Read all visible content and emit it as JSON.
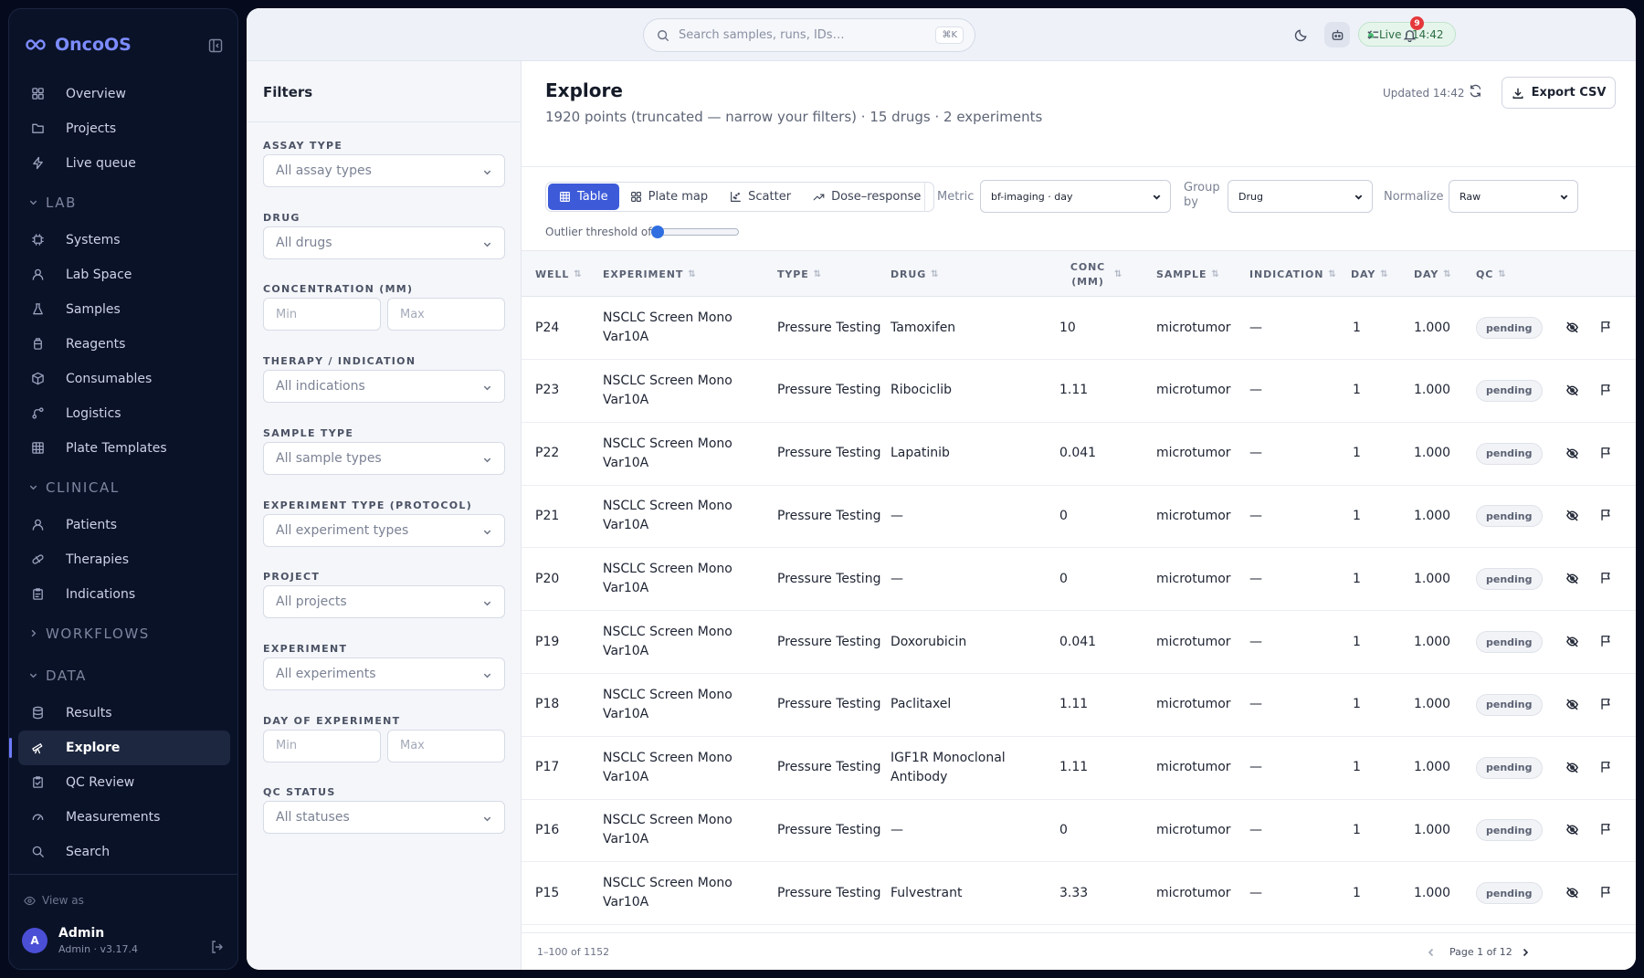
{
  "app": {
    "name": "OncoOS"
  },
  "sidebar": {
    "top_items": [
      {
        "label": "Overview",
        "icon": "grid-icon"
      },
      {
        "label": "Projects",
        "icon": "folder-icon"
      },
      {
        "label": "Live queue",
        "icon": "bolt-icon"
      }
    ],
    "sections": [
      {
        "label": "LAB",
        "expanded": true,
        "items": [
          {
            "label": "Systems",
            "icon": "chip-icon"
          },
          {
            "label": "Lab Space",
            "icon": "user-icon"
          },
          {
            "label": "Samples",
            "icon": "flask-icon"
          },
          {
            "label": "Reagents",
            "icon": "bottle-icon"
          },
          {
            "label": "Consumables",
            "icon": "box-icon"
          },
          {
            "label": "Logistics",
            "icon": "route-icon"
          },
          {
            "label": "Plate Templates",
            "icon": "table-icon"
          }
        ]
      },
      {
        "label": "CLINICAL",
        "expanded": true,
        "items": [
          {
            "label": "Patients",
            "icon": "user-icon"
          },
          {
            "label": "Therapies",
            "icon": "pill-icon"
          },
          {
            "label": "Indications",
            "icon": "clipboard-icon"
          }
        ]
      },
      {
        "label": "WORKFLOWS",
        "expanded": false,
        "items": []
      },
      {
        "label": "DATA",
        "expanded": true,
        "items": [
          {
            "label": "Results",
            "icon": "database-icon"
          },
          {
            "label": "Explore",
            "icon": "telescope-icon",
            "active": true
          },
          {
            "label": "QC Review",
            "icon": "clipboard-check-icon"
          },
          {
            "label": "Measurements",
            "icon": "gauge-icon"
          },
          {
            "label": "Search",
            "icon": "search-icon"
          }
        ]
      }
    ],
    "view_as": "View as",
    "user": {
      "initial": "A",
      "name": "Admin",
      "sub": "Admin · v3.17.4"
    }
  },
  "topbar": {
    "search_placeholder": "Search samples, runs, IDs…",
    "shortcut": "⌘K",
    "live_label": "Live · 14:42",
    "notifications": "9"
  },
  "filters": {
    "title": "Filters",
    "groups": [
      {
        "label": "ASSAY TYPE",
        "kind": "select",
        "value": "All assay types"
      },
      {
        "label": "DRUG",
        "kind": "select",
        "value": "All drugs"
      },
      {
        "label": "CONCENTRATION (MM)",
        "kind": "range",
        "min": "Min",
        "max": "Max"
      },
      {
        "label": "THERAPY / INDICATION",
        "kind": "select",
        "value": "All indications"
      },
      {
        "label": "SAMPLE TYPE",
        "kind": "select",
        "value": "All sample types"
      },
      {
        "label": "EXPERIMENT TYPE (PROTOCOL)",
        "kind": "select",
        "value": "All experiment types"
      },
      {
        "label": "PROJECT",
        "kind": "select",
        "value": "All projects"
      },
      {
        "label": "EXPERIMENT",
        "kind": "select",
        "value": "All experiments"
      },
      {
        "label": "DAY OF EXPERIMENT",
        "kind": "range",
        "min": "Min",
        "max": "Max"
      },
      {
        "label": "QC STATUS",
        "kind": "select",
        "value": "All statuses"
      }
    ]
  },
  "explore": {
    "title": "Explore",
    "subtitle": "1920 points (truncated — narrow your filters) · 15 drugs · 2 experiments",
    "updated": "Updated 14:42",
    "export_label": "Export CSV",
    "views": [
      {
        "label": "Table",
        "icon": "table-icon",
        "active": true
      },
      {
        "label": "Plate map",
        "icon": "grid-icon"
      },
      {
        "label": "Scatter",
        "icon": "scatter-icon"
      },
      {
        "label": "Dose–response",
        "icon": "trend-icon"
      }
    ],
    "metric_label": "Metric",
    "metric_value": "bf-imaging · day",
    "groupby_label": "Group by",
    "groupby_value": "Drug",
    "normalize_label": "Normalize",
    "normalize_value": "Raw",
    "outlier_label": "Outlier threshold off",
    "outlier_value": 0
  },
  "table": {
    "columns": [
      {
        "label": "Well"
      },
      {
        "label": "Experiment"
      },
      {
        "label": "Type"
      },
      {
        "label": "Drug"
      },
      {
        "label": "Conc (µM)"
      },
      {
        "label": "Sample"
      },
      {
        "label": "Indication"
      },
      {
        "label": "Day"
      },
      {
        "label": "day"
      },
      {
        "label": "QC"
      }
    ],
    "rows": [
      {
        "well": "P24",
        "experiment": "NSCLC Screen Mono Var10A",
        "type": "Pressure Testing",
        "drug": "Tamoxifen",
        "conc": "10",
        "sample": "microtumor",
        "indication": "—",
        "day": "1",
        "dayval": "1.000",
        "qc": "pending"
      },
      {
        "well": "P23",
        "experiment": "NSCLC Screen Mono Var10A",
        "type": "Pressure Testing",
        "drug": "Ribociclib",
        "conc": "1.11",
        "sample": "microtumor",
        "indication": "—",
        "day": "1",
        "dayval": "1.000",
        "qc": "pending"
      },
      {
        "well": "P22",
        "experiment": "NSCLC Screen Mono Var10A",
        "type": "Pressure Testing",
        "drug": "Lapatinib",
        "conc": "0.041",
        "sample": "microtumor",
        "indication": "—",
        "day": "1",
        "dayval": "1.000",
        "qc": "pending"
      },
      {
        "well": "P21",
        "experiment": "NSCLC Screen Mono Var10A",
        "type": "Pressure Testing",
        "drug": "—",
        "conc": "0",
        "sample": "microtumor",
        "indication": "—",
        "day": "1",
        "dayval": "1.000",
        "qc": "pending"
      },
      {
        "well": "P20",
        "experiment": "NSCLC Screen Mono Var10A",
        "type": "Pressure Testing",
        "drug": "—",
        "conc": "0",
        "sample": "microtumor",
        "indication": "—",
        "day": "1",
        "dayval": "1.000",
        "qc": "pending"
      },
      {
        "well": "P19",
        "experiment": "NSCLC Screen Mono Var10A",
        "type": "Pressure Testing",
        "drug": "Doxorubicin",
        "conc": "0.041",
        "sample": "microtumor",
        "indication": "—",
        "day": "1",
        "dayval": "1.000",
        "qc": "pending"
      },
      {
        "well": "P18",
        "experiment": "NSCLC Screen Mono Var10A",
        "type": "Pressure Testing",
        "drug": "Paclitaxel",
        "conc": "1.11",
        "sample": "microtumor",
        "indication": "—",
        "day": "1",
        "dayval": "1.000",
        "qc": "pending"
      },
      {
        "well": "P17",
        "experiment": "NSCLC Screen Mono Var10A",
        "type": "Pressure Testing",
        "drug": "IGF1R Monoclonal Antibody",
        "conc": "1.11",
        "sample": "microtumor",
        "indication": "—",
        "day": "1",
        "dayval": "1.000",
        "qc": "pending"
      },
      {
        "well": "P16",
        "experiment": "NSCLC Screen Mono Var10A",
        "type": "Pressure Testing",
        "drug": "—",
        "conc": "0",
        "sample": "microtumor",
        "indication": "—",
        "day": "1",
        "dayval": "1.000",
        "qc": "pending"
      },
      {
        "well": "P15",
        "experiment": "NSCLC Screen Mono Var10A",
        "type": "Pressure Testing",
        "drug": "Fulvestrant",
        "conc": "3.33",
        "sample": "microtumor",
        "indication": "—",
        "day": "1",
        "dayval": "1.000",
        "qc": "pending"
      }
    ],
    "range_text": "1–100 of 1152",
    "page_text": "Page 1 of 12"
  },
  "colors": {
    "accent": "#3d5bd9",
    "brand": "#7c8cff",
    "sidebar_bg": "#0a1228",
    "live": "#4bbf74",
    "badge": "#e5383b"
  }
}
